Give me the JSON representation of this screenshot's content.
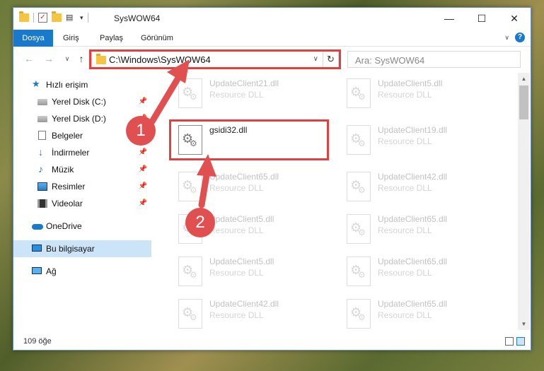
{
  "titlebar": {
    "title": "SysWOW64",
    "minimize": "—",
    "maximize": "☐",
    "close": "✕"
  },
  "ribbon": {
    "tabs": [
      "Dosya",
      "Giriş",
      "Paylaş",
      "Görünüm"
    ],
    "help": "?",
    "chevron": "∨"
  },
  "nav": {
    "back": "←",
    "forward": "→",
    "recent": "∨",
    "up": "↑",
    "address": "C:\\Windows\\SysWOW64",
    "address_dd": "∨",
    "refresh": "↻",
    "search_placeholder": "Ara: SysWOW64"
  },
  "sidebar": {
    "items": [
      {
        "label": "Hızlı erişim",
        "icon": "star-icon",
        "pinned": false
      },
      {
        "label": "Yerel Disk (C:)",
        "icon": "disk-icon",
        "pinned": true
      },
      {
        "label": "Yerel Disk (D:)",
        "icon": "disk-icon",
        "pinned": true
      },
      {
        "label": "Belgeler",
        "icon": "document-icon",
        "pinned": true
      },
      {
        "label": "İndirmeler",
        "icon": "download-icon",
        "pinned": true
      },
      {
        "label": "Müzik",
        "icon": "music-icon",
        "pinned": true
      },
      {
        "label": "Resimler",
        "icon": "pictures-icon",
        "pinned": true
      },
      {
        "label": "Videolar",
        "icon": "videos-icon",
        "pinned": true
      },
      {
        "label": "OneDrive",
        "icon": "cloud-icon",
        "pinned": false
      },
      {
        "label": "Bu bilgisayar",
        "icon": "computer-icon",
        "pinned": false
      },
      {
        "label": "Ağ",
        "icon": "network-icon",
        "pinned": false
      }
    ],
    "pin_glyph": "📌"
  },
  "files": {
    "left": [
      {
        "name": "UpdateClient21.dll",
        "type": "Resource DLL"
      },
      {
        "name": "gsidi32.dll",
        "type": ""
      },
      {
        "name": "UpdateClient65.dll",
        "type": "Resource DLL"
      },
      {
        "name": "UpdateClient5.dll",
        "type": "Resource DLL"
      },
      {
        "name": "UpdateClient5.dll",
        "type": "Resource DLL"
      },
      {
        "name": "UpdateClient42.dll",
        "type": "Resource DLL"
      }
    ],
    "right": [
      {
        "name": "UpdateClient5.dll",
        "type": "Resource DLL"
      },
      {
        "name": "UpdateClient19.dll",
        "type": "Resource DLL"
      },
      {
        "name": "UpdateClient42.dll",
        "type": "Resource DLL"
      },
      {
        "name": "UpdateClient65.dll",
        "type": "Resource DLL"
      },
      {
        "name": "UpdateClient65.dll",
        "type": "Resource DLL"
      },
      {
        "name": "UpdateClient65.dll",
        "type": "Resource DLL"
      }
    ]
  },
  "status": {
    "count": "109 öğe"
  },
  "callouts": {
    "one": "1",
    "two": "2"
  },
  "colors": {
    "accent": "#1979ca",
    "highlight": "#e04040",
    "selected": "#cce4f7"
  }
}
